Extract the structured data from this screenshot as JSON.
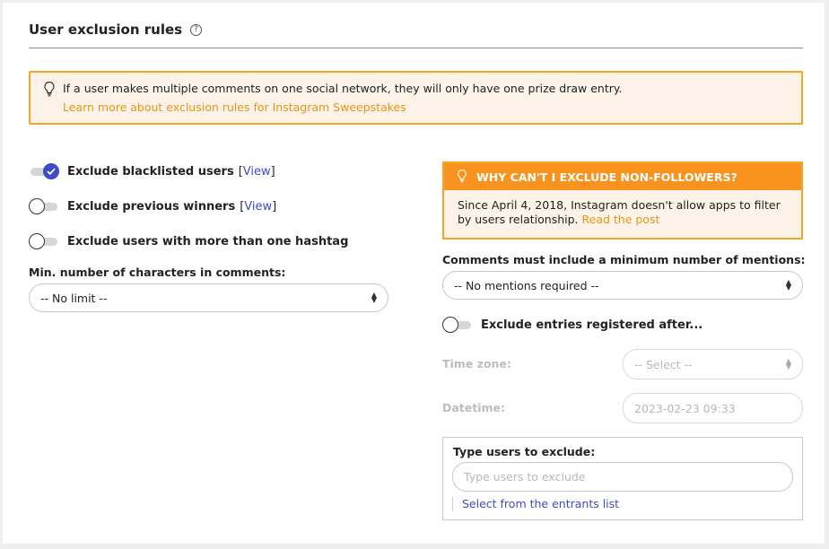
{
  "header": {
    "title": "User exclusion rules",
    "help_glyph": "?"
  },
  "notice": {
    "text": "If a user makes multiple comments on one social network, they will only have one prize draw entry.",
    "link": "Learn more about exclusion rules for Instagram Sweepstakes"
  },
  "left": {
    "toggles": [
      {
        "label": "Exclude blacklisted users",
        "on": true,
        "view_open": "[",
        "view_link": "View",
        "view_close": "]"
      },
      {
        "label": "Exclude previous winners",
        "on": false,
        "view_open": "[",
        "view_link": "View",
        "view_close": "]"
      },
      {
        "label": "Exclude users with more than one hashtag",
        "on": false
      }
    ],
    "min_chars": {
      "label": "Min. number of characters in comments:",
      "value": "-- No limit --"
    }
  },
  "right": {
    "warning": {
      "title": "WHY CAN'T I EXCLUDE NON-FOLLOWERS?",
      "text": "Since April 4, 2018, Instagram doesn't allow apps to filter by users relationship.",
      "link": "Read the post"
    },
    "mentions": {
      "label": "Comments must include a minimum number of mentions:",
      "value": "-- No mentions required --"
    },
    "registered_toggle": {
      "label": "Exclude entries registered after...",
      "on": false
    },
    "timezone": {
      "label": "Time zone:",
      "value": "-- Select --"
    },
    "datetime": {
      "label": "Datetime:",
      "value": "2023-02-23 09:33"
    },
    "exclude_users": {
      "label": "Type users to exclude:",
      "placeholder": "Type users to exclude",
      "select_link": "Select from the entrants list"
    }
  },
  "colors": {
    "accent": "#3e4bc7",
    "warning": "#f7931e",
    "notice_bg": "#fdf3e8"
  }
}
